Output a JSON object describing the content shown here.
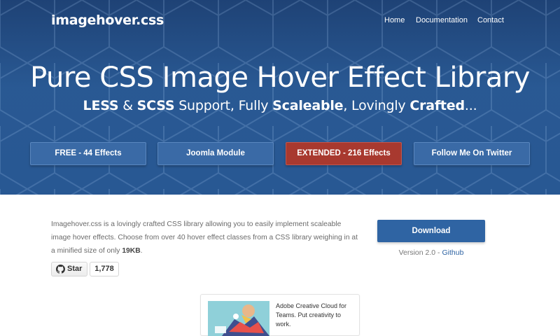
{
  "header": {
    "brand": "imagehover.css",
    "nav": [
      "Home",
      "Documentation",
      "Contact"
    ]
  },
  "hero": {
    "headline": "Pure CSS Image Hover Effect Library",
    "subline": {
      "part1": "LESS",
      "part2": " & ",
      "part3": "SCSS",
      "part4": " Support, Fully ",
      "part5": "Scaleable",
      "part6": ", Lovingly ",
      "part7": "Crafted",
      "part8": "..."
    },
    "buttons": [
      {
        "label": "FREE - 44 Effects"
      },
      {
        "label": "Joomla Module"
      },
      {
        "label": "EXTENDED - 216 Effects"
      },
      {
        "label": "Follow Me On Twitter"
      }
    ]
  },
  "intro": {
    "text": "Imagehover.css is a lovingly crafted CSS library allowing you to easily implement scaleable image hover effects. Choose from over 40 hover effect classes from a CSS library weighing in at a minified size of only ",
    "size": "19KB",
    "end": "."
  },
  "github": {
    "star_label": "Star",
    "star_count": "1,778"
  },
  "download": {
    "label": "Download",
    "version_prefix": "Version 2.0 - ",
    "github_link": "Github"
  },
  "ad": {
    "text": "Adobe Creative Cloud for Teams. Put creativity to work."
  },
  "colors": {
    "hero_blue": "#2b5c97",
    "button_blue": "#3a6aa6",
    "button_red": "#a8392f",
    "download_blue": "#2f64a3"
  },
  "icons": {
    "github": "github-octocat-icon"
  }
}
